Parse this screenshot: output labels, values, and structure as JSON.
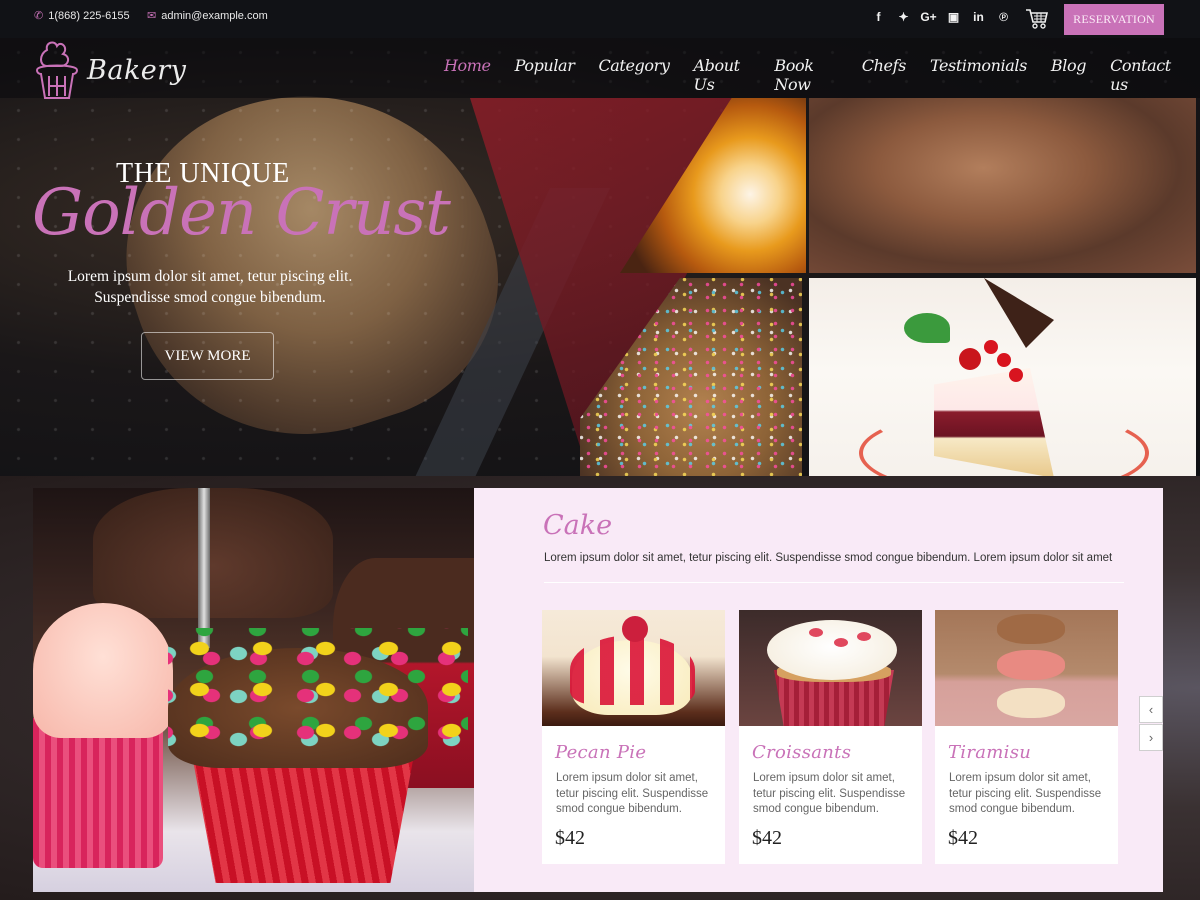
{
  "topbar": {
    "phone": "1(868) 225-6155",
    "email": "admin@example.com",
    "phone_icon": "phone-icon",
    "email_icon": "envelope-icon",
    "socials": [
      {
        "name": "facebook-icon",
        "glyph": "f"
      },
      {
        "name": "twitter-icon",
        "glyph": "❀"
      },
      {
        "name": "google-plus-icon",
        "glyph": "G+"
      },
      {
        "name": "instagram-icon",
        "glyph": "▣"
      },
      {
        "name": "linkedin-icon",
        "glyph": "in"
      },
      {
        "name": "pinterest-icon",
        "glyph": "℗"
      }
    ],
    "cart_icon": "shopping-cart-icon",
    "reservation_label": "RESERVATION"
  },
  "brand": {
    "name": "Bakery",
    "logo_icon": "cupcake-icon",
    "accent_color": "#c972b8"
  },
  "nav": {
    "items": [
      {
        "label": "Home",
        "active": true
      },
      {
        "label": "Popular"
      },
      {
        "label": "Category"
      },
      {
        "label": "About Us"
      },
      {
        "label": "Book Now"
      },
      {
        "label": "Chefs"
      },
      {
        "label": "Testimonials"
      },
      {
        "label": "Blog"
      },
      {
        "label": "Contact us"
      }
    ]
  },
  "hero": {
    "kicker": "THE UNIQUE",
    "headline": "Golden Crust",
    "subtext_line1": "Lorem ipsum dolor sit amet, tetur piscing elit.",
    "subtext_line2": "Suspendisse smod congue bibendum.",
    "cta_label": "VIEW MORE"
  },
  "menu": {
    "title": "Cake",
    "description": "Lorem ipsum dolor sit amet, tetur piscing elit. Suspendisse smod congue bibendum. Lorem ipsum dolor sit amet",
    "items": [
      {
        "title": "Pecan Pie",
        "description": "Lorem ipsum dolor sit amet, tetur piscing elit. Suspendisse smod congue bibendum.",
        "price": "$42"
      },
      {
        "title": "Croissants",
        "description": "Lorem ipsum dolor sit amet, tetur piscing elit. Suspendisse smod congue bibendum.",
        "price": "$42"
      },
      {
        "title": "Tiramisu",
        "description": "Lorem ipsum dolor sit amet, tetur piscing elit. Suspendisse smod congue bibendum.",
        "price": "$42"
      }
    ],
    "prev_glyph": "‹",
    "next_glyph": "›"
  }
}
